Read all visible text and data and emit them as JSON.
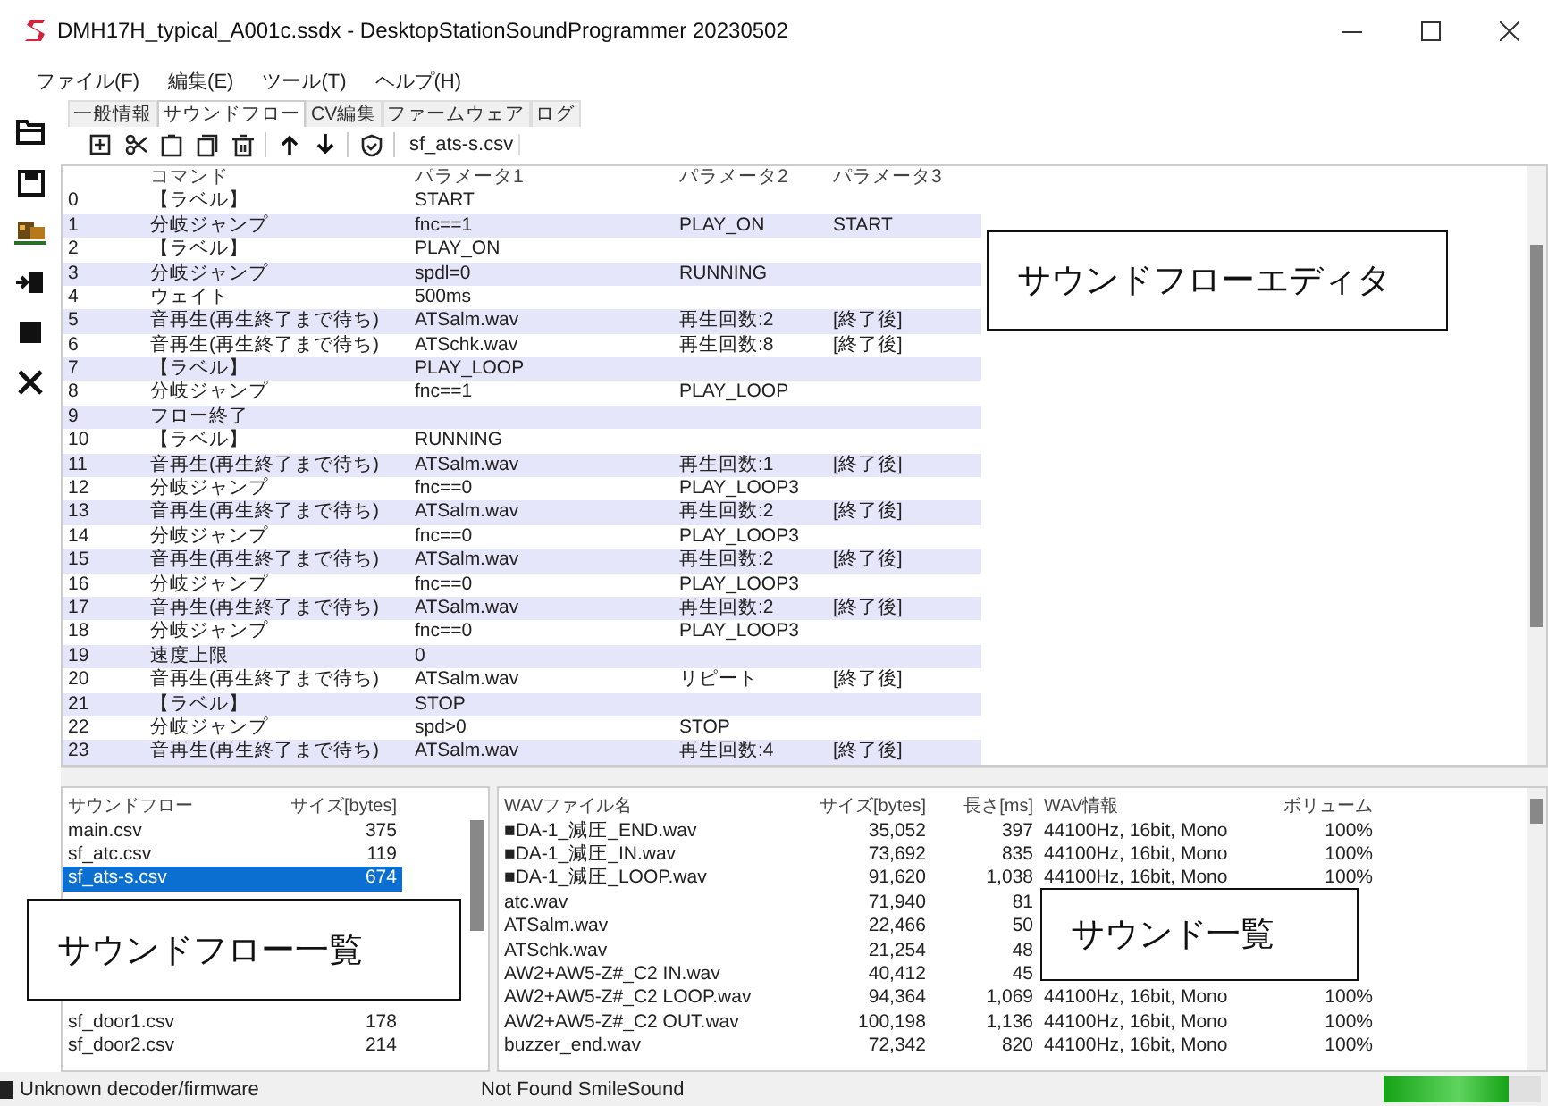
{
  "window": {
    "title": "DMH17H_typical_A001c.ssdx - DesktopStationSoundProgrammer 20230502"
  },
  "menu": [
    "ファイル(F)",
    "編集(E)",
    "ツール(T)",
    "ヘルプ(H)"
  ],
  "tabs": [
    {
      "label": "一般情報",
      "selected": false
    },
    {
      "label": "サウンドフロー",
      "selected": true
    },
    {
      "label": "CV編集",
      "selected": false
    },
    {
      "label": "ファームウェア",
      "selected": false
    },
    {
      "label": "ログ",
      "selected": false
    }
  ],
  "editor": {
    "file": "sf_ats-s.csv",
    "columns": [
      "コマンド",
      "パラメータ1",
      "パラメータ2",
      "パラメータ3"
    ],
    "rows": [
      {
        "no": "0",
        "command": "【ラベル】",
        "param1": "START"
      },
      {
        "no": "1",
        "command": "分岐ジャンプ",
        "param1": "fnc==1",
        "param2": "PLAY_ON",
        "param3": "START"
      },
      {
        "no": "2",
        "command": "【ラベル】",
        "param1": "PLAY_ON"
      },
      {
        "no": "3",
        "command": "分岐ジャンプ",
        "param1": "spdl=0",
        "param2": "RUNNING"
      },
      {
        "no": "4",
        "command": "ウェイト",
        "param1": "500ms"
      },
      {
        "no": "5",
        "command": "音再生(再生終了まで待ち)",
        "param1": "ATSalm.wav",
        "param2": "再生回数:2",
        "param3": "[終了後]"
      },
      {
        "no": "6",
        "command": "音再生(再生終了まで待ち)",
        "param1": "ATSchk.wav",
        "param2": "再生回数:8",
        "param3": "[終了後]"
      },
      {
        "no": "7",
        "command": "【ラベル】",
        "param1": "PLAY_LOOP"
      },
      {
        "no": "8",
        "command": "分岐ジャンプ",
        "param1": "fnc==1",
        "param2": "PLAY_LOOP"
      },
      {
        "no": "9",
        "command": "フロー終了"
      },
      {
        "no": "10",
        "command": "【ラベル】",
        "param1": "RUNNING"
      },
      {
        "no": "11",
        "command": "音再生(再生終了まで待ち)",
        "param1": "ATSalm.wav",
        "param2": "再生回数:1",
        "param3": "[終了後]"
      },
      {
        "no": "12",
        "command": "分岐ジャンプ",
        "param1": "fnc==0",
        "param2": "PLAY_LOOP3"
      },
      {
        "no": "13",
        "command": "音再生(再生終了まで待ち)",
        "param1": "ATSalm.wav",
        "param2": "再生回数:2",
        "param3": "[終了後]"
      },
      {
        "no": "14",
        "command": "分岐ジャンプ",
        "param1": "fnc==0",
        "param2": "PLAY_LOOP3"
      },
      {
        "no": "15",
        "command": "音再生(再生終了まで待ち)",
        "param1": "ATSalm.wav",
        "param2": "再生回数:2",
        "param3": "[終了後]"
      },
      {
        "no": "16",
        "command": "分岐ジャンプ",
        "param1": "fnc==0",
        "param2": "PLAY_LOOP3"
      },
      {
        "no": "17",
        "command": "音再生(再生終了まで待ち)",
        "param1": "ATSalm.wav",
        "param2": "再生回数:2",
        "param3": "[終了後]"
      },
      {
        "no": "18",
        "command": "分岐ジャンプ",
        "param1": "fnc==0",
        "param2": "PLAY_LOOP3"
      },
      {
        "no": "19",
        "command": "速度上限",
        "param1": "0"
      },
      {
        "no": "20",
        "command": "音再生(再生終了まで待ち)",
        "param1": "ATSalm.wav",
        "param2": "リピート",
        "param3": "[終了後]"
      },
      {
        "no": "21",
        "command": "【ラベル】",
        "param1": "STOP"
      },
      {
        "no": "22",
        "command": "分岐ジャンプ",
        "param1": "spd>0",
        "param2": "STOP"
      },
      {
        "no": "23",
        "command": "音再生(再生終了まで待ち)",
        "param1": "ATSalm.wav",
        "param2": "再生回数:4",
        "param3": "[終了後]"
      }
    ],
    "callout": "サウンドフローエディタ"
  },
  "flow_list": {
    "columns": [
      "サウンドフロー",
      "サイズ[bytes]"
    ],
    "rows_before": [
      {
        "name": "main.csv",
        "size": "375",
        "selected": false
      },
      {
        "name": "sf_atc.csv",
        "size": "119",
        "selected": false
      },
      {
        "name": "sf_ats-s.csv",
        "size": "674",
        "selected": true
      }
    ],
    "rows_after": [
      {
        "name": "sf_door1.csv",
        "size": "178",
        "selected": false
      },
      {
        "name": "sf_door2.csv",
        "size": "214",
        "selected": false
      }
    ],
    "callout": "サウンドフロー一覧"
  },
  "sound_list": {
    "columns": [
      "WAVファイル名",
      "サイズ[bytes]",
      "長さ[ms]",
      "WAV情報",
      "ボリューム"
    ],
    "rows": [
      {
        "name": "■DA-1_減圧_END.wav",
        "size": "35,052",
        "length": "397",
        "info": "44100Hz, 16bit, Mono",
        "volume": "100%"
      },
      {
        "name": "■DA-1_減圧_IN.wav",
        "size": "73,692",
        "length": "835",
        "info": "44100Hz, 16bit, Mono",
        "volume": "100%"
      },
      {
        "name": "■DA-1_減圧_LOOP.wav",
        "size": "91,620",
        "length": "1,038",
        "info": "44100Hz, 16bit, Mono",
        "volume": "100%"
      },
      {
        "name": "atc.wav",
        "size": "71,940",
        "length": "81"
      },
      {
        "name": "ATSalm.wav",
        "size": "22,466",
        "length": "50"
      },
      {
        "name": "ATSchk.wav",
        "size": "21,254",
        "length": "48"
      },
      {
        "name": "AW2+AW5-Z#_C2 IN.wav",
        "size": "40,412",
        "length": "45"
      },
      {
        "name": "AW2+AW5-Z#_C2 LOOP.wav",
        "size": "94,364",
        "length": "1,069",
        "info": "44100Hz, 16bit, Mono",
        "volume": "100%"
      },
      {
        "name": "AW2+AW5-Z#_C2 OUT.wav",
        "size": "100,198",
        "length": "1,136",
        "info": "44100Hz, 16bit, Mono",
        "volume": "100%"
      },
      {
        "name": "buzzer_end.wav",
        "size": "72,342",
        "length": "820",
        "info": "44100Hz, 16bit, Mono",
        "volume": "100%"
      }
    ],
    "callout": "サウンド一覧"
  },
  "status_bar": {
    "decoder": "Unknown decoder/firmware",
    "sound": "Not Found SmileSound",
    "progress": {
      "level": 0.8
    }
  }
}
